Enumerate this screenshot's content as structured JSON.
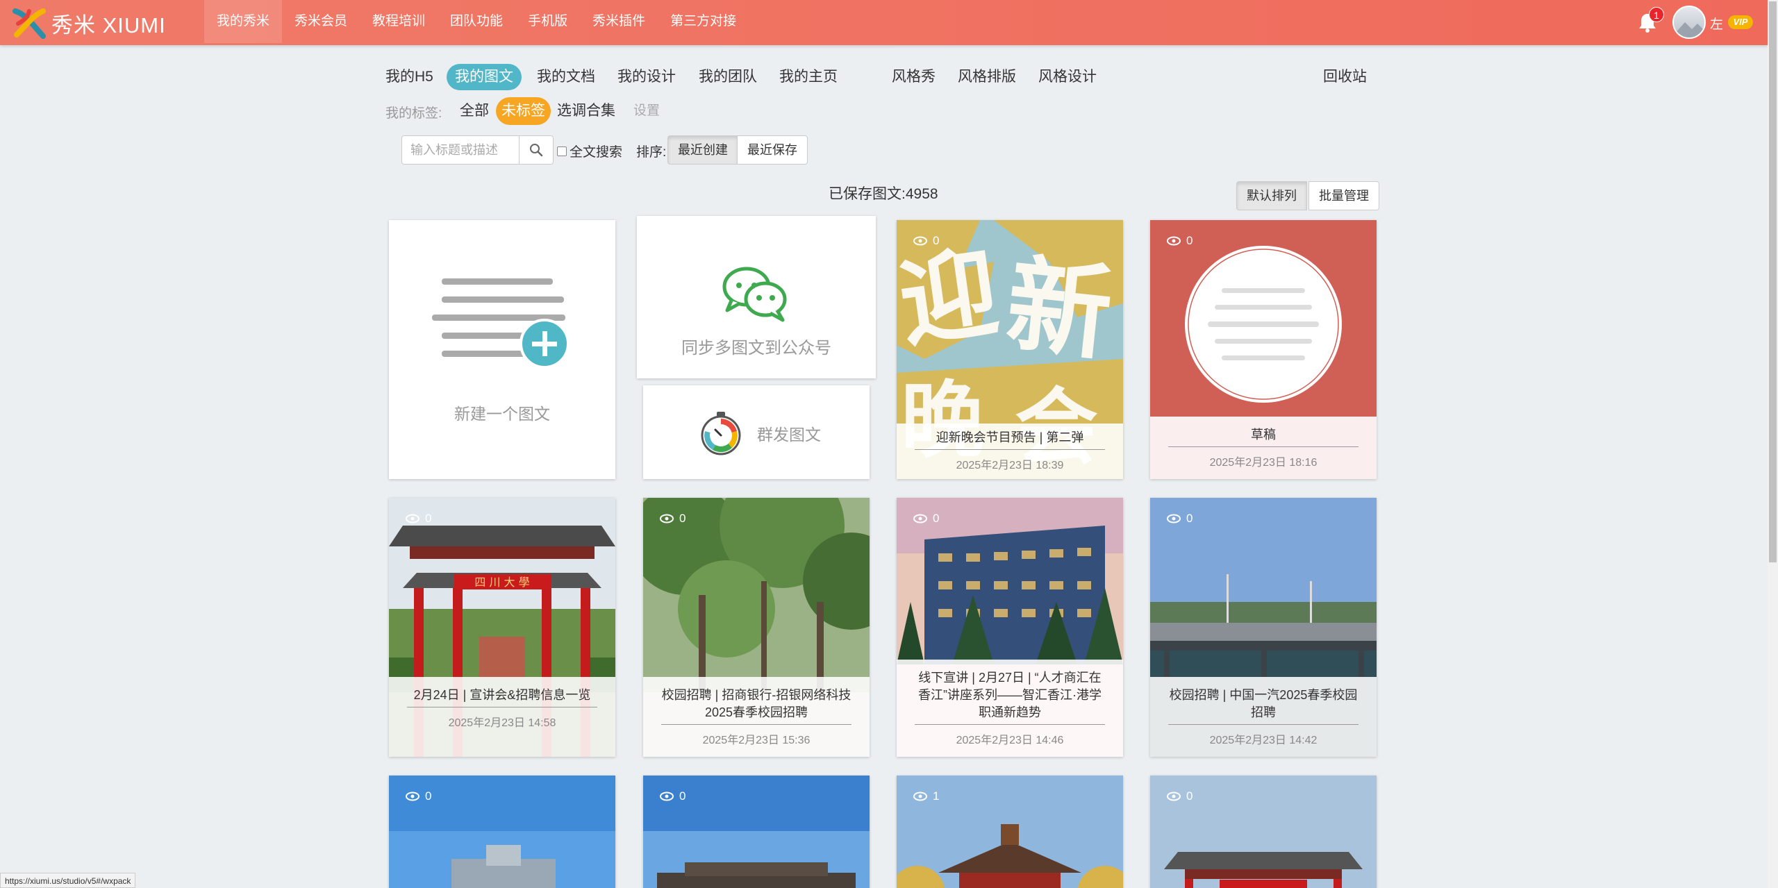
{
  "app": {
    "brand": "秀米 XIUMI",
    "accent": "#ef6a5b"
  },
  "nav": [
    {
      "label": "我的秀米",
      "active": true
    },
    {
      "label": "秀米会员"
    },
    {
      "label": "教程培训"
    },
    {
      "label": "团队功能"
    },
    {
      "label": "手机版"
    },
    {
      "label": "秀米插件"
    },
    {
      "label": "第三方对接"
    }
  ],
  "user": {
    "notifications": "1",
    "name": "左",
    "badge": "VIP"
  },
  "tabs": {
    "h5": "我的H5",
    "tuwen": "我的图文",
    "docs": "我的文档",
    "design": "我的设计",
    "team": "我的团队",
    "home": "我的主页",
    "style_show": "风格秀",
    "style_layout": "风格排版",
    "style_design": "风格设计",
    "trash": "回收站"
  },
  "tags": {
    "label": "我的标签:",
    "all": "全部",
    "untagged": "未标签",
    "collection": "选调合集",
    "settings": "设置"
  },
  "search": {
    "placeholder": "输入标题或描述",
    "fulltext": "全文搜索",
    "sort_label": "排序:",
    "recent_created": "最近创建",
    "recent_saved": "最近保存"
  },
  "summary": {
    "saved": "已保存图文:4958",
    "default_order": "默认排列",
    "batch_manage": "批量管理"
  },
  "actions": {
    "new": "新建一个图文",
    "sync": "同步多图文到公众号",
    "mass_send": "群发图文"
  },
  "cards": [
    {
      "views": "0",
      "title": "迎新晚会节目预告 | 第二弹",
      "date": "2025年2月23日 18:39"
    },
    {
      "views": "0",
      "title": "草稿",
      "date": "2025年2月23日 18:16"
    },
    {
      "views": "0",
      "title": "2月24日 | 宣讲会&招聘信息一览",
      "date": "2025年2月23日 14:58"
    },
    {
      "views": "0",
      "title": "校园招聘 | 招商银行-招银网络科技2025春季校园招聘",
      "date": "2025年2月23日 15:36"
    },
    {
      "views": "0",
      "title": "线下宣讲 | 2月27日 | “人才商汇在香江”讲座系列——智汇香江·港学职通新趋势",
      "date": "2025年2月23日 14:46"
    },
    {
      "views": "0",
      "title": "校园招聘 | 中国一汽2025春季校园招聘",
      "date": "2025年2月23日 14:42"
    },
    {
      "views": "0"
    },
    {
      "views": "0"
    },
    {
      "views": "1"
    },
    {
      "views": "0"
    }
  ],
  "statusbar": {
    "url": "https://xiumi.us/studio/v5#/wxpack"
  }
}
